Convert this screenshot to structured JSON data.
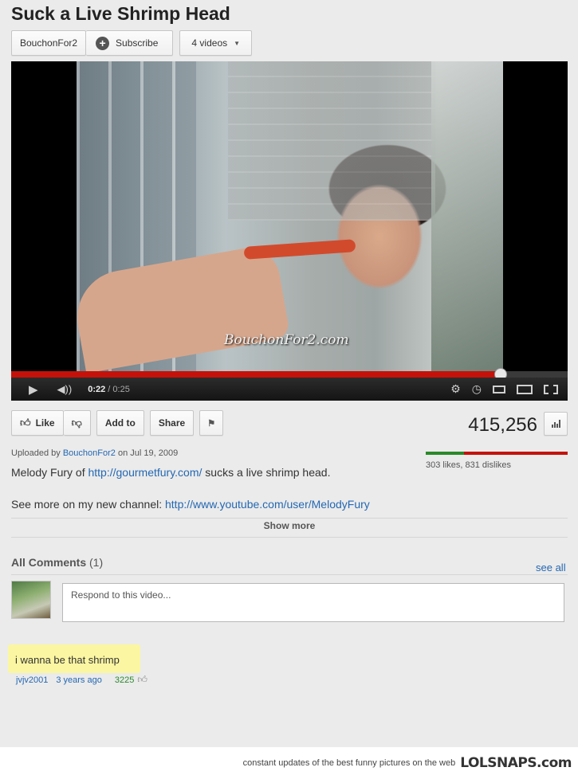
{
  "video": {
    "title": "Suck a Live Shrimp Head",
    "watermark": "BouchonFor2.com"
  },
  "channel": {
    "name": "BouchonFor2",
    "subscribe_label": "Subscribe",
    "videos_label": "4 videos"
  },
  "player": {
    "current_time": "0:22",
    "separator": " / ",
    "duration": "0:25",
    "progress_fraction": 0.88
  },
  "actions": {
    "like_label": "Like",
    "add_to_label": "Add to",
    "share_label": "Share"
  },
  "stats": {
    "view_count": "415,256",
    "likes_text": "303 likes, 831 dislikes",
    "like_fraction": 0.267
  },
  "upload": {
    "prefix": "Uploaded by",
    "uploader": "BouchonFor2",
    "date_text": "on Jul 19, 2009"
  },
  "description": {
    "line1_prefix": "Melody Fury of",
    "line1_link": "http://gourmetfury.com/",
    "line1_suffix": "sucks a live shrimp head.",
    "line2_prefix": "See more on my new channel:",
    "line2_link": "http://www.youtube.com/user/MelodyFury",
    "show_more": "Show more"
  },
  "comments": {
    "heading": "All Comments",
    "count": "(1)",
    "see_all": "see all",
    "respond_placeholder": "Respond to this video...",
    "items": [
      {
        "text": "i wanna be that  shrimp",
        "author": "jvjv2001",
        "age": "3 years ago",
        "votes": "3225"
      }
    ]
  },
  "footer": {
    "tagline": "constant updates of the best funny pictures on the web",
    "brand": "LOLSNAPS.com"
  },
  "colors": {
    "progress_red": "#c4120b",
    "like_green": "#2a8a2a",
    "link_blue": "#2468b3",
    "highlight_yellow": "#fbf6a2"
  }
}
